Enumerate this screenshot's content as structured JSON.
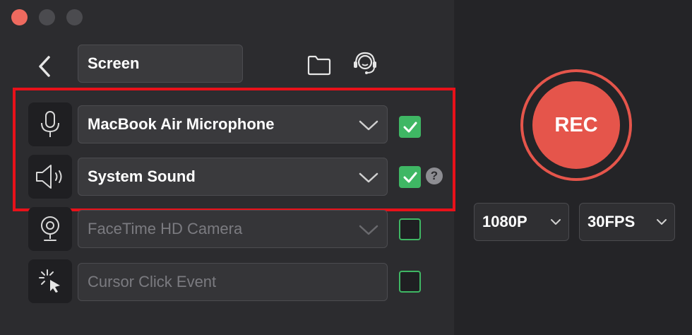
{
  "header": {
    "mode_value": "Screen"
  },
  "sources": {
    "microphone": {
      "label": "MacBook Air Microphone",
      "checked": true
    },
    "system_sound": {
      "label": "System Sound",
      "checked": true,
      "help": "?"
    },
    "camera": {
      "label": "FaceTime HD Camera",
      "checked": false
    },
    "cursor": {
      "label": "Cursor Click Event",
      "checked": false
    }
  },
  "record": {
    "rec_label": "REC",
    "resolution": "1080P",
    "framerate": "30FPS"
  },
  "colors": {
    "accent_red": "#e5554b",
    "check_green": "#3fb764",
    "highlight_red": "#e8111a"
  },
  "icons": [
    "back-chevron-icon",
    "folder-icon",
    "headset-support-icon",
    "microphone-icon",
    "speaker-icon",
    "webcam-icon",
    "cursor-click-icon",
    "checkmark-icon",
    "chevron-down-icon"
  ]
}
